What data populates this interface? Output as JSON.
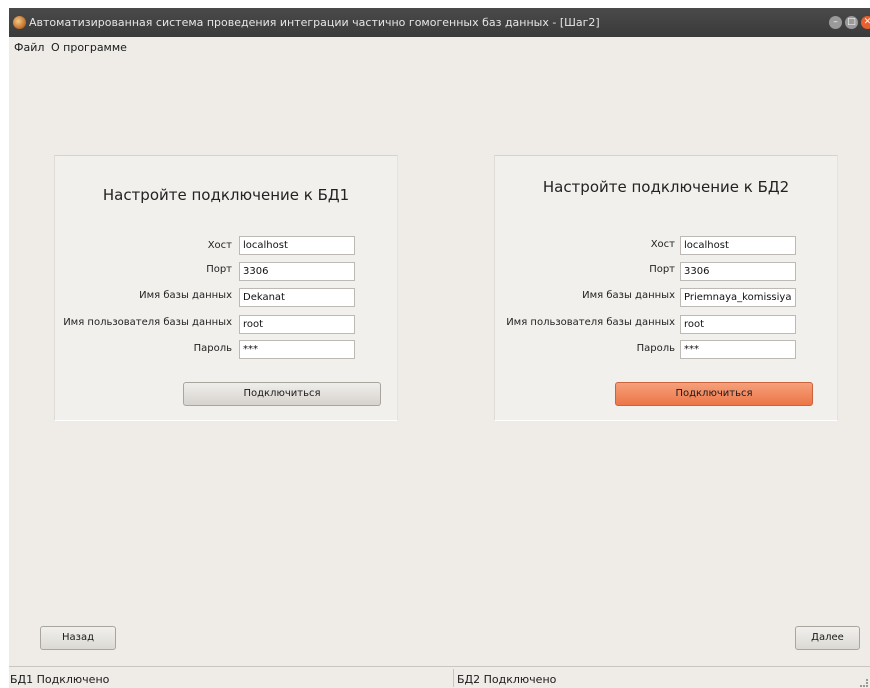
{
  "window": {
    "title": "Автоматизированная система проведения интеграции частично гомогенных баз данных - [Шаг2]",
    "app_icon": "app-logo-icon",
    "controls": [
      "minimize-icon",
      "maximize-icon",
      "close-icon"
    ],
    "close_color": "#e9602e"
  },
  "menu": {
    "file": "Файл",
    "about": "О программе"
  },
  "db1": {
    "title": "Настройте подключение к БД1",
    "labels": {
      "host": "Хост",
      "port": "Порт",
      "dbname": "Имя базы данных",
      "user": "Имя пользователя базы данных",
      "password": "Пароль"
    },
    "values": {
      "host": "localhost",
      "port": "3306",
      "dbname": "Dekanat",
      "user": "root",
      "password": "***"
    },
    "connect": "Подключиться"
  },
  "db2": {
    "title": "Настройте подключение к БД2",
    "labels": {
      "host": "Хост",
      "port": "Порт",
      "dbname": "Имя базы данных",
      "user": "Имя пользователя базы данных",
      "password": "Пароль"
    },
    "values": {
      "host": "localhost",
      "port": "3306",
      "dbname": "Priemnaya_komissiya",
      "user": "root",
      "password": "***"
    },
    "connect": "Подключиться",
    "connect_color": "#ec7548"
  },
  "nav": {
    "back": "Назад",
    "next": "Далее"
  },
  "status": {
    "db1": "БД1 Подключено",
    "db2": "БД2 Подключено"
  }
}
